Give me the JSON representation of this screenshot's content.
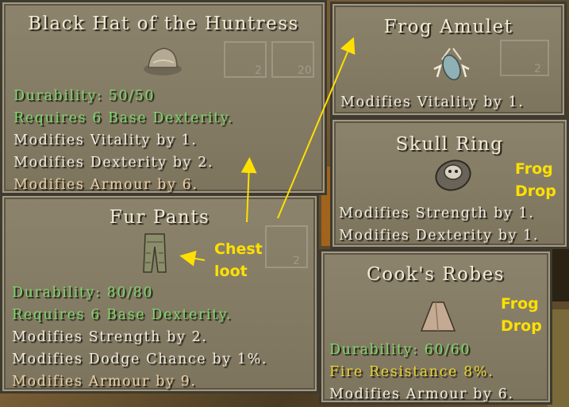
{
  "items": [
    {
      "title": "Black Hat of the Huntress",
      "icon": "hat-icon",
      "lines": [
        {
          "text": "Durability: 50/50",
          "color": "#7cd46a"
        },
        {
          "text": "Requires 6 Base Dexterity.",
          "color": "#7cd46a"
        },
        {
          "text": "Modifies Vitality by 1.",
          "color": "#f0ece0"
        },
        {
          "text": "Modifies Dexterity by 2.",
          "color": "#f0ece0"
        },
        {
          "text": "Modifies Armour by 6.",
          "color": "#ead0a6"
        }
      ]
    },
    {
      "title": "Frog Amulet",
      "icon": "amulet-icon",
      "lines": [
        {
          "text": "Modifies Vitality by 1.",
          "color": "#f0ece0"
        }
      ]
    },
    {
      "title": "Skull Ring",
      "icon": "ring-icon",
      "lines": [
        {
          "text": "Modifies Strength by 1.",
          "color": "#f0ece0"
        },
        {
          "text": "Modifies Dexterity by 1.",
          "color": "#f0ece0"
        }
      ]
    },
    {
      "title": "Fur Pants",
      "icon": "pants-icon",
      "lines": [
        {
          "text": "Durability: 80/80",
          "color": "#7cd46a"
        },
        {
          "text": "Requires 6 Base Dexterity.",
          "color": "#7cd46a"
        },
        {
          "text": "Modifies Strength by 2.",
          "color": "#f0ece0"
        },
        {
          "text": "Modifies Dodge Chance by 1%.",
          "color": "#f0ece0"
        },
        {
          "text": "Modifies Armour by 9.",
          "color": "#ead0a6"
        }
      ]
    },
    {
      "title": "Cook's Robes",
      "icon": "robe-icon",
      "lines": [
        {
          "text": "Durability: 60/60",
          "color": "#7cd46a"
        },
        {
          "text": "Fire Resistance 8%.",
          "color": "#e8d232"
        },
        {
          "text": "Modifies Armour by 6.",
          "color": "#f0ece0"
        }
      ]
    }
  ],
  "annotations": {
    "chest_loot": [
      "Chest",
      "loot"
    ],
    "frog_drop_ring": [
      "Frog",
      "Drop"
    ],
    "frog_drop_robes": [
      "Frog",
      "Drop"
    ],
    "color": "#ffe000"
  },
  "ghost_counts": [
    "2",
    "20",
    "2",
    "2"
  ]
}
